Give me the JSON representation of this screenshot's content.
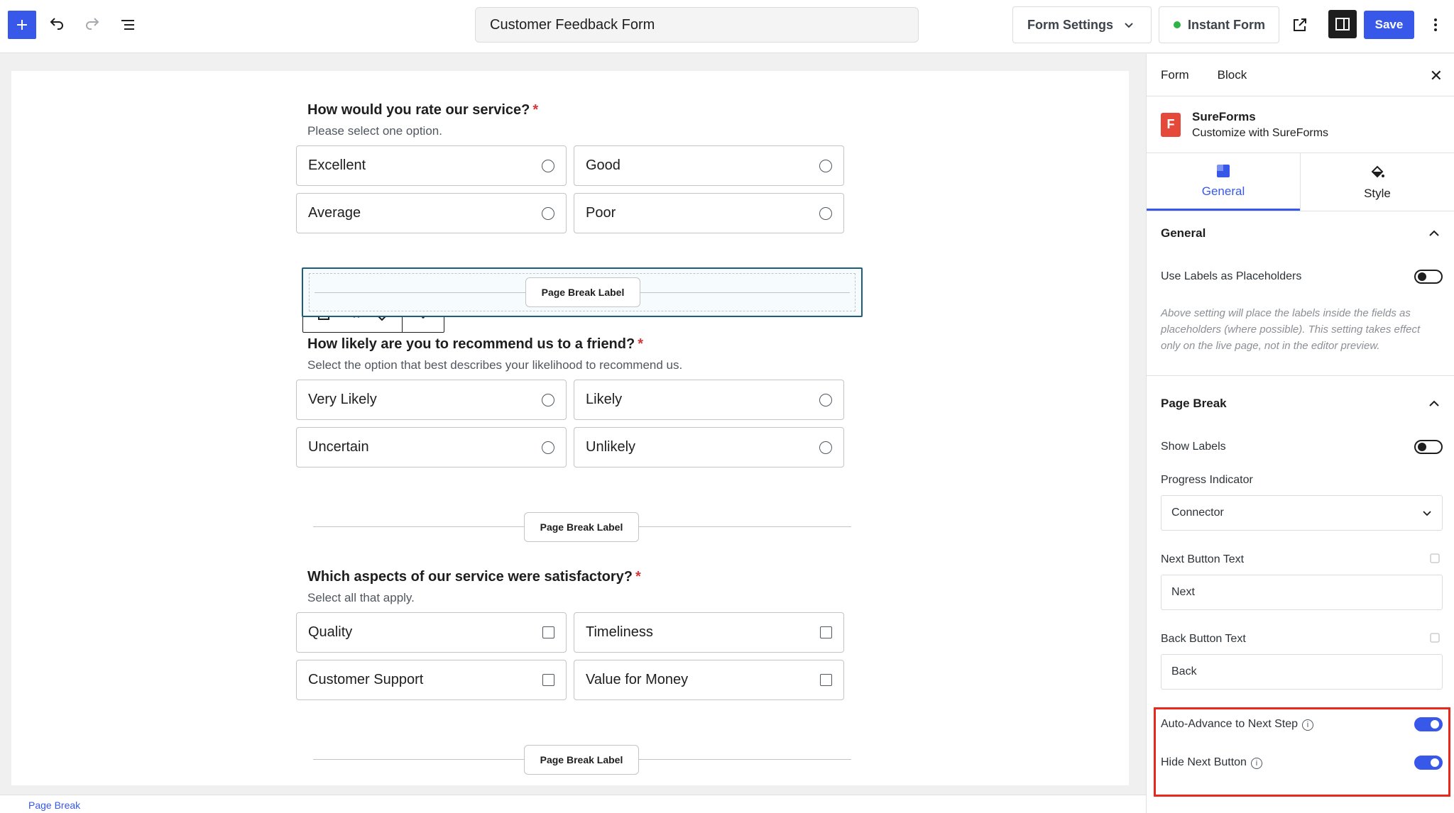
{
  "header": {
    "form_title": "Customer Feedback Form",
    "form_settings_label": "Form Settings",
    "instant_form_label": "Instant Form",
    "save_label": "Save"
  },
  "canvas": {
    "q1": {
      "title": "How would you rate our service?",
      "help": "Please select one option.",
      "options": [
        "Excellent",
        "Good",
        "Average",
        "Poor"
      ]
    },
    "q2": {
      "title": "How likely are you to recommend us to a friend?",
      "help": "Select the option that best describes your likelihood to recommend us.",
      "options": [
        "Very Likely",
        "Likely",
        "Uncertain",
        "Unlikely"
      ]
    },
    "q3": {
      "title": "Which aspects of our service were satisfactory?",
      "help": "Select all that apply.",
      "options": [
        "Quality",
        "Timeliness",
        "Customer Support",
        "Value for Money"
      ]
    },
    "required_mark": "*",
    "page_break_label": "Page Break Label",
    "footer_breadcrumb": "Page Break"
  },
  "panel": {
    "tabs": [
      "Form",
      "Block"
    ],
    "plugin": {
      "name": "SureForms",
      "subtitle": "Customize with SureForms",
      "logo_letter": "F"
    },
    "sub_tabs": [
      "General",
      "Style"
    ],
    "general_section": {
      "title": "General",
      "use_labels_placeholders": "Use Labels as Placeholders",
      "note": "Above setting will place the labels inside the fields as placeholders (where possible). This setting takes effect only on the live page, not in the editor preview."
    },
    "page_break_section": {
      "title": "Page Break",
      "show_labels": "Show Labels",
      "progress_indicator_label": "Progress Indicator",
      "progress_indicator_value": "Connector",
      "next_button_text_label": "Next Button Text",
      "next_button_text_value": "Next",
      "back_button_text_label": "Back Button Text",
      "back_button_text_value": "Back",
      "auto_advance_label": "Auto-Advance to Next Step",
      "hide_next_label": "Hide Next Button"
    },
    "toggles": {
      "use_labels_placeholders": false,
      "show_labels": false,
      "auto_advance": true,
      "hide_next": true
    }
  },
  "colors": {
    "accent": "#3858e9",
    "highlight": "#e8281c",
    "required": "#d63638",
    "brand": "#e5493a"
  }
}
